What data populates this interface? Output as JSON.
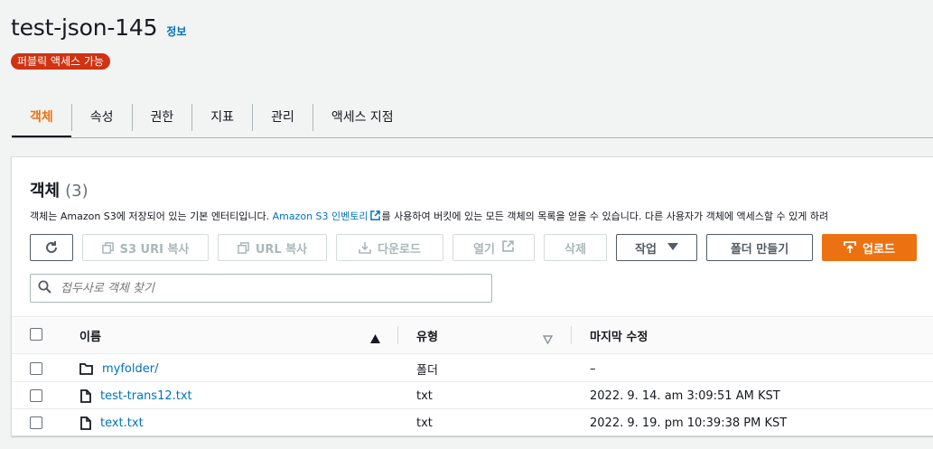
{
  "header": {
    "bucket_name": "test-json-145",
    "info_link": "정보",
    "public_badge": "퍼블릭 액세스 가능"
  },
  "tabs": [
    {
      "label": "객체",
      "active": true
    },
    {
      "label": "속성",
      "active": false
    },
    {
      "label": "권한",
      "active": false
    },
    {
      "label": "지표",
      "active": false
    },
    {
      "label": "관리",
      "active": false
    },
    {
      "label": "액세스 지점",
      "active": false
    }
  ],
  "objects_panel": {
    "title": "객체",
    "count": "(3)",
    "description_prefix": "객체는 Amazon S3에 저장되어 있는 기본 엔터티입니다. ",
    "description_link": "Amazon S3 인벤토리",
    "description_suffix": "를 사용하여 버킷에 있는 모든 객체의 목록을 얻을 수 있습니다. 다른 사용자가 객체에 액세스할 수 있게 하려",
    "toolbar": {
      "refresh_icon": "refresh-icon",
      "copy_s3_uri": "S3 URI 복사",
      "copy_url": "URL 복사",
      "download": "다운로드",
      "open": "열기",
      "delete": "삭제",
      "actions": "작업",
      "create_folder": "폴더 만들기",
      "upload": "업로드"
    },
    "search": {
      "placeholder": "접두사로 객체 찾기"
    },
    "table": {
      "columns": [
        "이름",
        "유형",
        "마지막 수정"
      ],
      "rows": [
        {
          "name": "myfolder/",
          "type": "폴더",
          "modified": "–",
          "icon": "folder-icon"
        },
        {
          "name": "test-trans12.txt",
          "type": "txt",
          "modified": "2022. 9. 14. am 3:09:51 AM KST",
          "icon": "file-icon"
        },
        {
          "name": "text.txt",
          "type": "txt",
          "modified": "2022. 9. 19. pm 10:39:38 PM KST",
          "icon": "file-icon"
        }
      ]
    }
  },
  "colors": {
    "accent": "#ec7211",
    "link": "#0073bb",
    "badge": "#d13212",
    "text": "#16191f"
  }
}
